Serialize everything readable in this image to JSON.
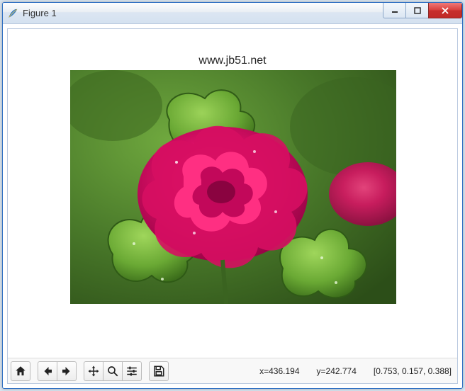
{
  "window": {
    "title": "Figure 1"
  },
  "plot": {
    "title": "www.jb51.net"
  },
  "status": {
    "x_label": "x=436.194",
    "y_label": "y=242.774",
    "rgb": "[0.753, 0.157, 0.388]"
  },
  "toolbar": {
    "home": "home",
    "back": "back",
    "forward": "forward",
    "pan": "pan",
    "zoom": "zoom",
    "configure": "configure",
    "save": "save"
  }
}
